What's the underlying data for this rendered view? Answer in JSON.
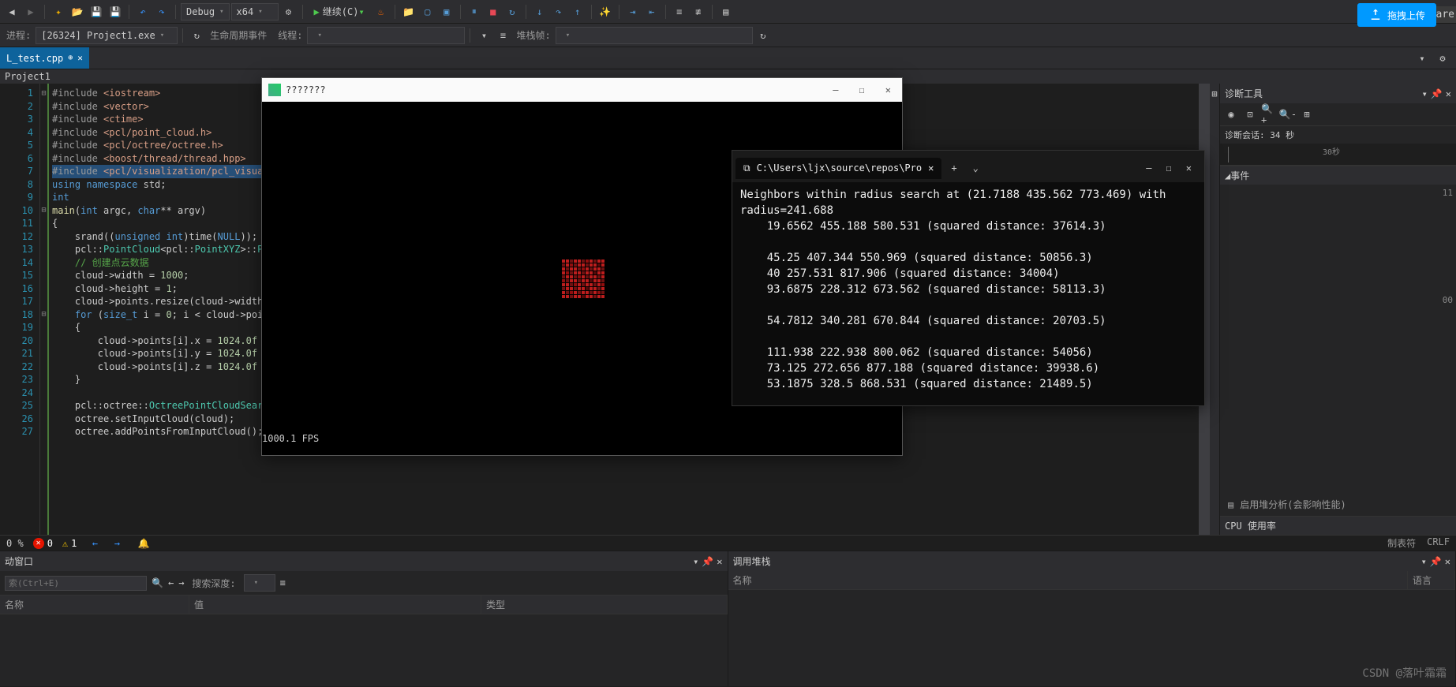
{
  "toolbar1": {
    "config": "Debug",
    "platform": "x64",
    "continue": "继续(C)"
  },
  "toolbar2": {
    "process_label": "进程:",
    "process_value": "[26324] Project1.exe",
    "lifecycle_label": "生命周期事件",
    "thread_label": "线程:",
    "stackframe_label": "堆栈帧:"
  },
  "tabs": {
    "active": "L_test.cpp"
  },
  "project": "Project1",
  "code_lines": [
    {
      "n": 1,
      "f": "⊟",
      "seg": [
        {
          "c": "c-pp",
          "t": "#include "
        },
        {
          "c": "c-str",
          "t": "<iostream>"
        }
      ]
    },
    {
      "n": 2,
      "f": "",
      "seg": [
        {
          "c": "c-pp",
          "t": "#include "
        },
        {
          "c": "c-str",
          "t": "<vector>"
        }
      ]
    },
    {
      "n": 3,
      "f": "",
      "seg": [
        {
          "c": "c-pp",
          "t": "#include "
        },
        {
          "c": "c-str",
          "t": "<ctime>"
        }
      ]
    },
    {
      "n": 4,
      "f": "",
      "seg": [
        {
          "c": "c-pp",
          "t": "#include "
        },
        {
          "c": "c-str",
          "t": "<pcl/point_cloud.h>"
        }
      ]
    },
    {
      "n": 5,
      "f": "",
      "seg": [
        {
          "c": "c-pp",
          "t": "#include "
        },
        {
          "c": "c-str",
          "t": "<pcl/octree/octree.h>"
        }
      ]
    },
    {
      "n": 6,
      "f": "",
      "seg": [
        {
          "c": "c-pp",
          "t": "#include "
        },
        {
          "c": "c-str",
          "t": "<boost/thread/thread.hpp>"
        }
      ]
    },
    {
      "n": 7,
      "f": "",
      "hl": true,
      "seg": [
        {
          "c": "c-pp",
          "t": "#include "
        },
        {
          "c": "c-str",
          "t": "<pcl/visualization/pcl_visual"
        }
      ]
    },
    {
      "n": 8,
      "f": "",
      "seg": [
        {
          "c": "c-kw",
          "t": "using namespace "
        },
        {
          "c": "c-ns",
          "t": "std"
        },
        {
          "c": "",
          "t": ";"
        }
      ]
    },
    {
      "n": 9,
      "f": "",
      "seg": [
        {
          "c": "c-kw",
          "t": "int"
        }
      ]
    },
    {
      "n": 10,
      "f": "⊟",
      "seg": [
        {
          "c": "c-fn",
          "t": "main"
        },
        {
          "c": "",
          "t": "("
        },
        {
          "c": "c-kw",
          "t": "int "
        },
        {
          "c": "",
          "t": "argc, "
        },
        {
          "c": "c-kw",
          "t": "char"
        },
        {
          "c": "",
          "t": "** argv)"
        }
      ]
    },
    {
      "n": 11,
      "f": "",
      "seg": [
        {
          "c": "",
          "t": "{"
        }
      ]
    },
    {
      "n": 12,
      "f": "",
      "seg": [
        {
          "c": "",
          "t": "    srand(("
        },
        {
          "c": "c-kw",
          "t": "unsigned int"
        },
        {
          "c": "",
          "t": ")time("
        },
        {
          "c": "c-kw",
          "t": "NULL"
        },
        {
          "c": "",
          "t": "));"
        }
      ]
    },
    {
      "n": 13,
      "f": "",
      "seg": [
        {
          "c": "",
          "t": "    pcl::"
        },
        {
          "c": "c-type",
          "t": "PointCloud"
        },
        {
          "c": "",
          "t": "<pcl::"
        },
        {
          "c": "c-type",
          "t": "PointXYZ"
        },
        {
          "c": "",
          "t": ">::"
        },
        {
          "c": "c-type",
          "t": "Pt"
        }
      ]
    },
    {
      "n": 14,
      "f": "",
      "seg": [
        {
          "c": "c-cmt",
          "t": "    // 创建点云数据"
        }
      ]
    },
    {
      "n": 15,
      "f": "",
      "seg": [
        {
          "c": "",
          "t": "    cloud->width = "
        },
        {
          "c": "c-num",
          "t": "1000"
        },
        {
          "c": "",
          "t": ";"
        }
      ]
    },
    {
      "n": 16,
      "f": "",
      "seg": [
        {
          "c": "",
          "t": "    cloud->height = "
        },
        {
          "c": "c-num",
          "t": "1"
        },
        {
          "c": "",
          "t": ";"
        }
      ]
    },
    {
      "n": 17,
      "f": "",
      "seg": [
        {
          "c": "",
          "t": "    cloud->points.resize(cloud->width"
        }
      ]
    },
    {
      "n": 18,
      "f": "⊟",
      "seg": [
        {
          "c": "c-kw",
          "t": "    for "
        },
        {
          "c": "",
          "t": "("
        },
        {
          "c": "c-kw",
          "t": "size_t "
        },
        {
          "c": "",
          "t": "i = "
        },
        {
          "c": "c-num",
          "t": "0"
        },
        {
          "c": "",
          "t": "; i < cloud->poin"
        }
      ]
    },
    {
      "n": 19,
      "f": "",
      "seg": [
        {
          "c": "",
          "t": "    {"
        }
      ]
    },
    {
      "n": 20,
      "f": "",
      "seg": [
        {
          "c": "",
          "t": "        cloud->points[i].x = "
        },
        {
          "c": "c-num",
          "t": "1024.0f "
        },
        {
          "c": "",
          "t": "*"
        }
      ]
    },
    {
      "n": 21,
      "f": "",
      "seg": [
        {
          "c": "",
          "t": "        cloud->points[i].y = "
        },
        {
          "c": "c-num",
          "t": "1024.0f "
        },
        {
          "c": "",
          "t": "*"
        }
      ]
    },
    {
      "n": 22,
      "f": "",
      "seg": [
        {
          "c": "",
          "t": "        cloud->points[i].z = "
        },
        {
          "c": "c-num",
          "t": "1024.0f "
        },
        {
          "c": "",
          "t": "*"
        }
      ]
    },
    {
      "n": 23,
      "f": "",
      "seg": [
        {
          "c": "",
          "t": "    }"
        }
      ]
    },
    {
      "n": 24,
      "f": "",
      "seg": [
        {
          "c": "",
          "t": ""
        }
      ]
    },
    {
      "n": 25,
      "f": "",
      "seg": [
        {
          "c": "",
          "t": "    pcl::octree::"
        },
        {
          "c": "c-type",
          "t": "OctreePointCloudSearc"
        }
      ]
    },
    {
      "n": 26,
      "f": "",
      "seg": [
        {
          "c": "",
          "t": "    octree.setInputCloud(cloud);"
        }
      ]
    },
    {
      "n": 27,
      "f": "",
      "seg": [
        {
          "c": "",
          "t": "    octree.addPointsFromInputCloud();"
        }
      ]
    }
  ],
  "vizwin": {
    "title": "???????",
    "fps": "1000.1 FPS"
  },
  "term": {
    "tab": "C:\\Users\\ljx\\source\\repos\\Pro",
    "lines": [
      "Neighbors within radius search at (21.7188 435.562 773.469) with radius=241.688",
      "    19.6562 455.188 580.531 (squared distance: 37614.3)",
      "",
      "    45.25 407.344 550.969 (squared distance: 50856.3)",
      "    40 257.531 817.906 (squared distance: 34004)",
      "    93.6875 228.312 673.562 (squared distance: 58113.3)",
      "",
      "    54.7812 340.281 670.844 (squared distance: 20703.5)",
      "",
      "    111.938 222.938 800.062 (squared distance: 54056)",
      "    73.125 272.656 877.188 (squared distance: 39938.6)",
      "    53.1875 328.5 868.531 (squared distance: 21489.5)"
    ]
  },
  "diag": {
    "title": "诊断工具",
    "session": "诊断会话: 34 秒",
    "tick": "30秒",
    "events_label": "◢事件",
    "sidebar_right": [
      "11",
      "",
      "",
      "00"
    ],
    "heap_item": "启用堆分析(会影响性能)",
    "cpu_label": "CPU 使用率"
  },
  "status": {
    "pct": "0 %",
    "err": "0",
    "wrn": "1",
    "tabchars": "制表符",
    "crlf": "CRLF"
  },
  "bottom": {
    "left_title": "动窗口",
    "search_placeholder": "索(Ctrl+E)",
    "depth_label": "搜索深度:",
    "col_name": "名称",
    "col_value": "值",
    "col_type": "类型",
    "right_title": "调用堆栈",
    "r_col_name": "名称",
    "r_col_lang": "语言"
  },
  "upload": "拖拽上传",
  "share_frag": "are",
  "watermark": "CSDN @落叶霜霜"
}
